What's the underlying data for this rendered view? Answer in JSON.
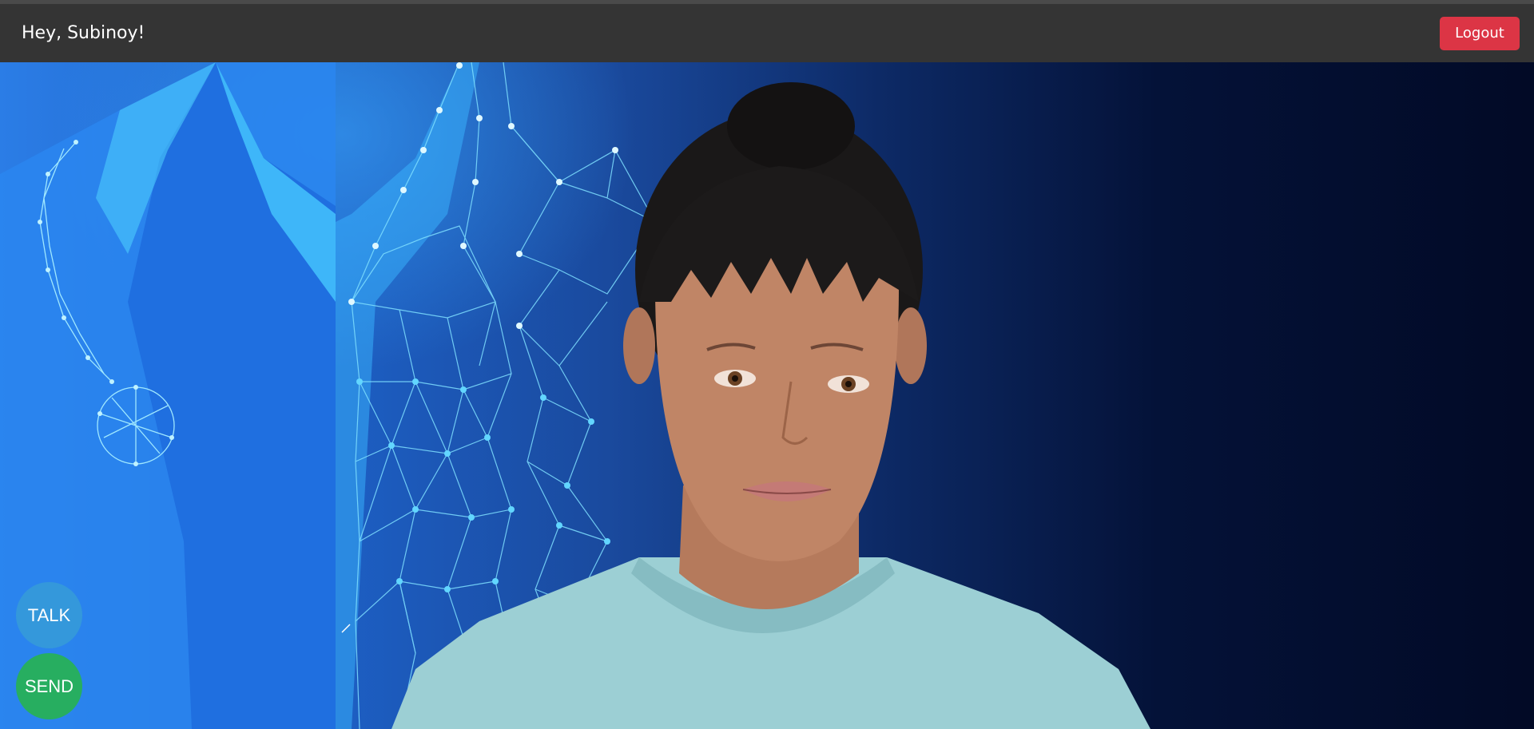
{
  "header": {
    "greeting": "Hey, Subinoy!",
    "logout_label": "Logout"
  },
  "controls": {
    "talk_label": "TALK",
    "send_label": "SEND"
  },
  "colors": {
    "header_bg": "#343434",
    "logout_bg": "#dc3545",
    "talk_bg": "#3498db",
    "send_bg": "#27ae60"
  },
  "scene": {
    "background": "doctor-coat-wireframe",
    "avatar": "female-avatar"
  }
}
